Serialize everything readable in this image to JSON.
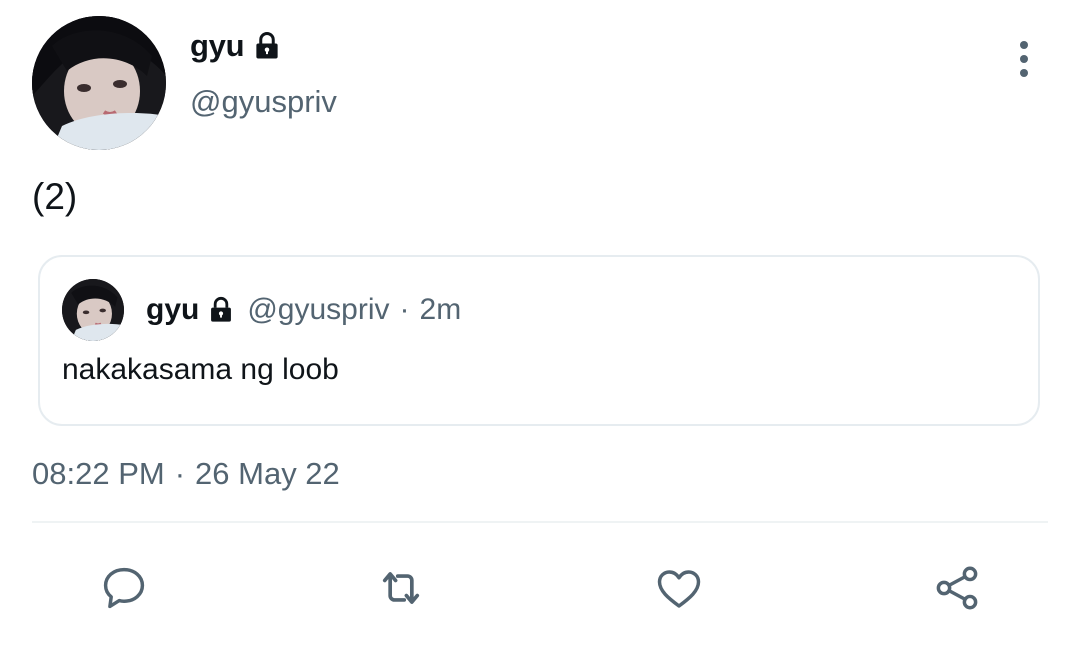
{
  "tweet": {
    "author": {
      "display_name": "gyu",
      "handle": "@gyuspriv",
      "protected_icon": "lock-icon"
    },
    "text": "(2)",
    "quoted_tweet": {
      "display_name": "gyu",
      "handle": "@gyuspriv",
      "separator": "·",
      "relative_time": "2m",
      "text": "nakakasama ng loob"
    },
    "time": "08:22 PM",
    "separator": "·",
    "date": "26 May 22"
  },
  "actions": [
    {
      "icon": "reply-icon"
    },
    {
      "icon": "retweet-icon"
    },
    {
      "icon": "like-icon"
    },
    {
      "icon": "share-icon"
    }
  ],
  "menu_icon": "more-options-icon",
  "colors": {
    "text_primary": "#0f1419",
    "text_secondary": "#536471",
    "border": "#e6ecf0",
    "icon": "#536471"
  }
}
